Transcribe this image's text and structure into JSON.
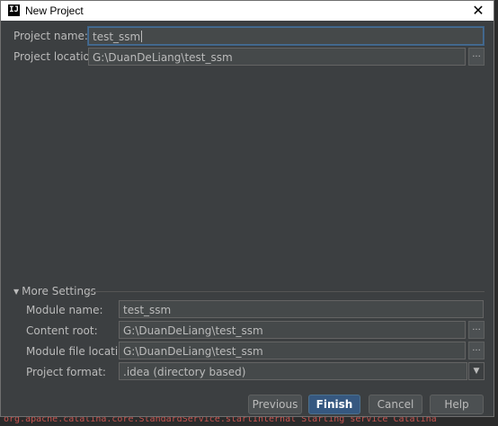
{
  "window": {
    "title": "New Project",
    "icon": "intellij-icon",
    "icon_text": "IJ",
    "close_glyph": "✕"
  },
  "project": {
    "name_label": "Project name:",
    "name_value": "test_ssm",
    "location_label": "Project location:",
    "location_value": "G:\\DuanDeLiang\\test_ssm",
    "browse_glyph": "..."
  },
  "more_settings": {
    "label": "More Settings",
    "expanded_glyph": "▼",
    "module_name_label": "Module name:",
    "module_name_value": "test_ssm",
    "content_root_label": "Content root:",
    "content_root_value": "G:\\DuanDeLiang\\test_ssm",
    "module_file_location_label": "Module file location:",
    "module_file_location_value": "G:\\DuanDeLiang\\test_ssm",
    "project_format_label": "Project format:",
    "project_format_value": ".idea (directory based)",
    "dropdown_glyph": "▼"
  },
  "buttons": {
    "previous": "Previous",
    "finish": "Finish",
    "cancel": "Cancel",
    "help": "Help"
  },
  "background": {
    "log_text": "org.apache.catalina.core.StandardService.startInternal Starting service Catalina"
  },
  "colors": {
    "dialog_bg": "#3c3f41",
    "field_bg": "#45494a",
    "primary_button": "#365880",
    "text": "#bbbbbb"
  }
}
